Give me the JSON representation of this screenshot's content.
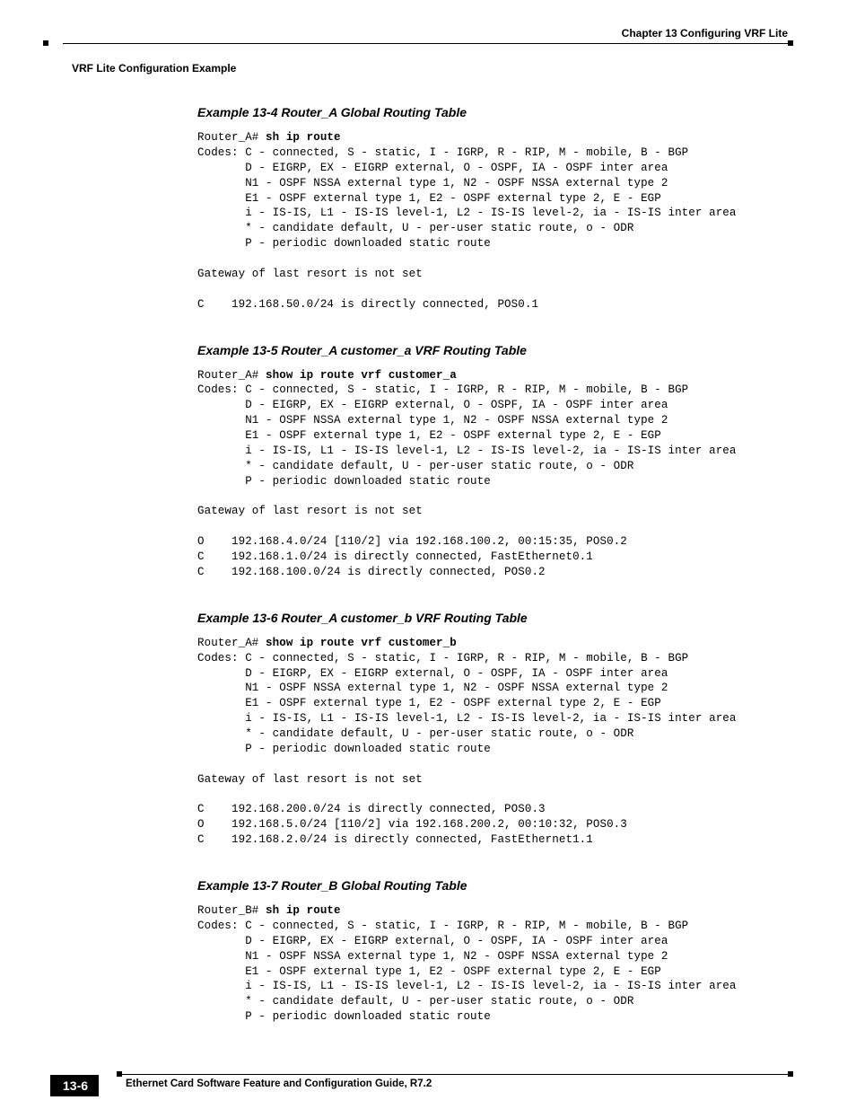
{
  "header": {
    "chapter": "Chapter 13 Configuring VRF Lite",
    "section": "VRF Lite Configuration Example"
  },
  "examples": {
    "ex4": {
      "title": "Example 13-4   Router_A Global Routing Table",
      "prompt": "Router_A# ",
      "cmd": "sh ip route",
      "body": "Codes: C - connected, S - static, I - IGRP, R - RIP, M - mobile, B - BGP\n       D - EIGRP, EX - EIGRP external, O - OSPF, IA - OSPF inter area\n       N1 - OSPF NSSA external type 1, N2 - OSPF NSSA external type 2\n       E1 - OSPF external type 1, E2 - OSPF external type 2, E - EGP\n       i - IS-IS, L1 - IS-IS level-1, L2 - IS-IS level-2, ia - IS-IS inter area\n       * - candidate default, U - per-user static route, o - ODR\n       P - periodic downloaded static route\n\nGateway of last resort is not set\n\nC    192.168.50.0/24 is directly connected, POS0.1"
    },
    "ex5": {
      "title": "Example 13-5   Router_A customer_a VRF Routing Table",
      "prompt": "Router_A# ",
      "cmd": "show ip route vrf customer_a",
      "body": "Codes: C - connected, S - static, I - IGRP, R - RIP, M - mobile, B - BGP\n       D - EIGRP, EX - EIGRP external, O - OSPF, IA - OSPF inter area\n       N1 - OSPF NSSA external type 1, N2 - OSPF NSSA external type 2\n       E1 - OSPF external type 1, E2 - OSPF external type 2, E - EGP\n       i - IS-IS, L1 - IS-IS level-1, L2 - IS-IS level-2, ia - IS-IS inter area\n       * - candidate default, U - per-user static route, o - ODR\n       P - periodic downloaded static route\n\nGateway of last resort is not set\n\nO    192.168.4.0/24 [110/2] via 192.168.100.2, 00:15:35, POS0.2\nC    192.168.1.0/24 is directly connected, FastEthernet0.1\nC    192.168.100.0/24 is directly connected, POS0.2"
    },
    "ex6": {
      "title": "Example 13-6   Router_A customer_b VRF Routing Table",
      "prompt": "Router_A# ",
      "cmd": "show ip route vrf customer_b",
      "body": "Codes: C - connected, S - static, I - IGRP, R - RIP, M - mobile, B - BGP\n       D - EIGRP, EX - EIGRP external, O - OSPF, IA - OSPF inter area\n       N1 - OSPF NSSA external type 1, N2 - OSPF NSSA external type 2\n       E1 - OSPF external type 1, E2 - OSPF external type 2, E - EGP\n       i - IS-IS, L1 - IS-IS level-1, L2 - IS-IS level-2, ia - IS-IS inter area\n       * - candidate default, U - per-user static route, o - ODR\n       P - periodic downloaded static route\n\nGateway of last resort is not set\n\nC    192.168.200.0/24 is directly connected, POS0.3\nO    192.168.5.0/24 [110/2] via 192.168.200.2, 00:10:32, POS0.3\nC    192.168.2.0/24 is directly connected, FastEthernet1.1"
    },
    "ex7": {
      "title": "Example 13-7   Router_B Global Routing Table",
      "prompt": "Router_B# ",
      "cmd": "sh ip route",
      "body": "Codes: C - connected, S - static, I - IGRP, R - RIP, M - mobile, B - BGP\n       D - EIGRP, EX - EIGRP external, O - OSPF, IA - OSPF inter area\n       N1 - OSPF NSSA external type 1, N2 - OSPF NSSA external type 2\n       E1 - OSPF external type 1, E2 - OSPF external type 2, E - EGP\n       i - IS-IS, L1 - IS-IS level-1, L2 - IS-IS level-2, ia - IS-IS inter area\n       * - candidate default, U - per-user static route, o - ODR\n       P - periodic downloaded static route"
    }
  },
  "footer": {
    "guide": "Ethernet Card Software Feature and Configuration Guide, R7.2",
    "page": "13-6"
  }
}
